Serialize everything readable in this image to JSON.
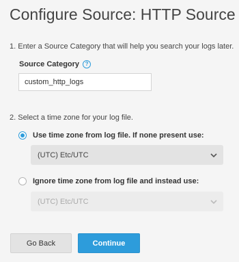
{
  "page": {
    "title": "Configure Source: HTTP Source"
  },
  "step1": {
    "text": "1. Enter a Source Category that will help you search your logs later.",
    "field_label": "Source Category",
    "input_value": "custom_http_logs"
  },
  "step2": {
    "text": "2. Select a time zone for your log file.",
    "option1": {
      "label": "Use time zone from log file. If none present use:",
      "checked": true,
      "select_value": "(UTC) Etc/UTC"
    },
    "option2": {
      "label": "Ignore time zone from log file and instead use:",
      "checked": false,
      "select_value": "(UTC) Etc/UTC"
    }
  },
  "buttons": {
    "back": "Go Back",
    "continue": "Continue"
  },
  "colors": {
    "accent": "#2d9cdb",
    "background": "#f5f5f5"
  }
}
